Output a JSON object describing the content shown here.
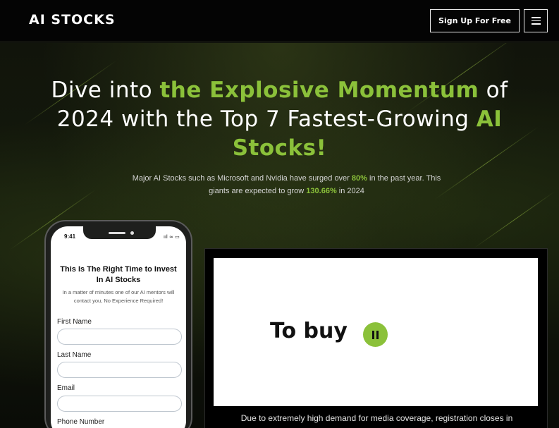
{
  "header": {
    "logo": "AI STOCKS",
    "signup_label": "Sign Up For Free",
    "menu_icon": "hamburger-menu-icon"
  },
  "hero": {
    "headline_parts": {
      "p1": "Dive into ",
      "p2": "the Explosive Momentum",
      "p3": " of 2024 with the Top 7 Fastest-Growing ",
      "p4": "AI Stocks!"
    },
    "sub_parts": {
      "s1": "Major AI Stocks such as Microsoft and Nvidia have surged over ",
      "s2": "80%",
      "s3": " in the past year. This giants are expected to grow ",
      "s4": "130.66%",
      "s5": " in 2024"
    }
  },
  "phone": {
    "time": "9:41",
    "status_icons": "ııl ≈ ▭",
    "form_title": "This Is The Right Time to Invest In AI Stocks",
    "form_desc": "In a matter of minutes one of our AI mentors will contact you, No Experience Required!",
    "fields": [
      {
        "label": "First Name"
      },
      {
        "label": "Last Name"
      },
      {
        "label": "Email"
      },
      {
        "label": "Phone Number"
      }
    ]
  },
  "video": {
    "frame_text": "To buy",
    "caption": "Due to extremely high demand for media coverage, registration closes in"
  },
  "colors": {
    "accent": "#8bc13a",
    "background": "#0b0d08"
  }
}
